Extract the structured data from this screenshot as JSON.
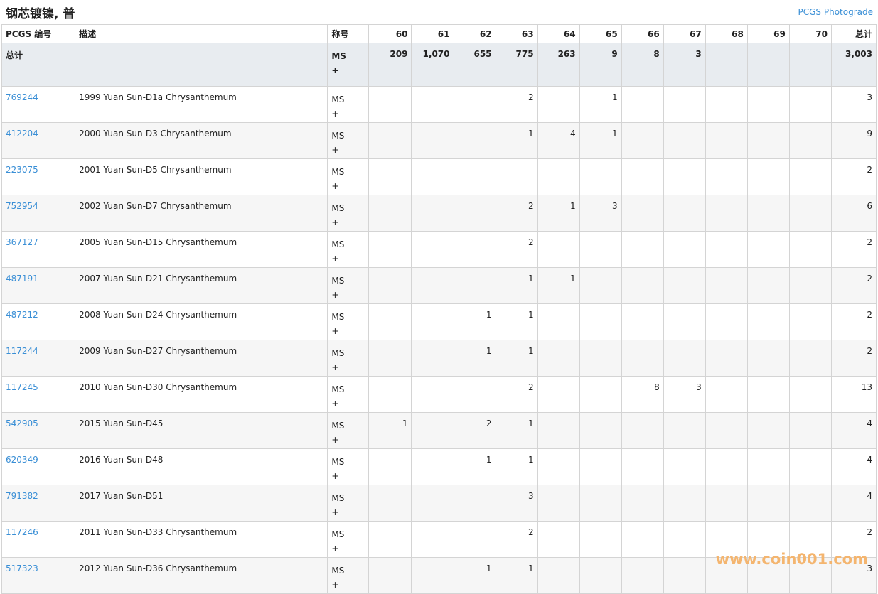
{
  "page": {
    "title": "钢芯镀镍, 普",
    "photograde_link": "PCGS Photograde",
    "watermark": "www.coin001.com"
  },
  "table": {
    "headers": {
      "pcgs_no": "PCGS 编号",
      "description": "描述",
      "designation": "称号",
      "grades": [
        "60",
        "61",
        "62",
        "63",
        "64",
        "65",
        "66",
        "67",
        "68",
        "69",
        "70"
      ],
      "total": "总计"
    },
    "total_row": {
      "label": "总计",
      "designation": [
        "MS",
        "+"
      ],
      "grades": [
        "209",
        "1,070",
        "655",
        "775",
        "263",
        "9",
        "8",
        "3",
        "",
        "",
        ""
      ],
      "total": "3,003"
    },
    "rows": [
      {
        "pcgs": "769244",
        "desc": "1999 Yuan Sun-D1a Chrysanthemum",
        "des": [
          "MS",
          "+"
        ],
        "grades": [
          "",
          "",
          "",
          "2",
          "",
          "1",
          "",
          "",
          "",
          "",
          ""
        ],
        "total": "3"
      },
      {
        "pcgs": "412204",
        "desc": "2000 Yuan Sun-D3 Chrysanthemum",
        "des": [
          "MS",
          "+"
        ],
        "grades": [
          "",
          "",
          "",
          "1",
          "4",
          "1",
          "",
          "",
          "",
          "",
          ""
        ],
        "total": "9"
      },
      {
        "pcgs": "223075",
        "desc": "2001 Yuan Sun-D5 Chrysanthemum",
        "des": [
          "MS",
          "+"
        ],
        "grades": [
          "",
          "",
          "",
          "",
          "",
          "",
          "",
          "",
          "",
          "",
          ""
        ],
        "total": "2"
      },
      {
        "pcgs": "752954",
        "desc": "2002 Yuan Sun-D7 Chrysanthemum",
        "des": [
          "MS",
          "+"
        ],
        "grades": [
          "",
          "",
          "",
          "2",
          "1",
          "3",
          "",
          "",
          "",
          "",
          ""
        ],
        "total": "6"
      },
      {
        "pcgs": "367127",
        "desc": "2005 Yuan Sun-D15 Chrysanthemum",
        "des": [
          "MS",
          "+"
        ],
        "grades": [
          "",
          "",
          "",
          "2",
          "",
          "",
          "",
          "",
          "",
          "",
          ""
        ],
        "total": "2"
      },
      {
        "pcgs": "487191",
        "desc": "2007 Yuan Sun-D21 Chrysanthemum",
        "des": [
          "MS",
          "+"
        ],
        "grades": [
          "",
          "",
          "",
          "1",
          "1",
          "",
          "",
          "",
          "",
          "",
          ""
        ],
        "total": "2"
      },
      {
        "pcgs": "487212",
        "desc": "2008 Yuan Sun-D24 Chrysanthemum",
        "des": [
          "MS",
          "+"
        ],
        "grades": [
          "",
          "",
          "1",
          "1",
          "",
          "",
          "",
          "",
          "",
          "",
          ""
        ],
        "total": "2"
      },
      {
        "pcgs": "117244",
        "desc": "2009 Yuan Sun-D27 Chrysanthemum",
        "des": [
          "MS",
          "+"
        ],
        "grades": [
          "",
          "",
          "1",
          "1",
          "",
          "",
          "",
          "",
          "",
          "",
          ""
        ],
        "total": "2"
      },
      {
        "pcgs": "117245",
        "desc": "2010 Yuan Sun-D30 Chrysanthemum",
        "des": [
          "MS",
          "+"
        ],
        "grades": [
          "",
          "",
          "",
          "2",
          "",
          "",
          "8",
          "3",
          "",
          "",
          ""
        ],
        "total": "13"
      },
      {
        "pcgs": "542905",
        "desc": "2015 Yuan Sun-D45",
        "des": [
          "MS",
          "+"
        ],
        "grades": [
          "1",
          "",
          "2",
          "1",
          "",
          "",
          "",
          "",
          "",
          "",
          ""
        ],
        "total": "4"
      },
      {
        "pcgs": "620349",
        "desc": "2016 Yuan Sun-D48",
        "des": [
          "MS",
          "+"
        ],
        "grades": [
          "",
          "",
          "1",
          "1",
          "",
          "",
          "",
          "",
          "",
          "",
          ""
        ],
        "total": "4"
      },
      {
        "pcgs": "791382",
        "desc": "2017 Yuan Sun-D51",
        "des": [
          "MS",
          "+"
        ],
        "grades": [
          "",
          "",
          "",
          "3",
          "",
          "",
          "",
          "",
          "",
          "",
          ""
        ],
        "total": "4"
      },
      {
        "pcgs": "117246",
        "desc": "2011 Yuan Sun-D33 Chrysanthemum",
        "des": [
          "MS",
          "+"
        ],
        "grades": [
          "",
          "",
          "",
          "2",
          "",
          "",
          "",
          "",
          "",
          "",
          ""
        ],
        "total": "2"
      },
      {
        "pcgs": "517323",
        "desc": "2012 Yuan Sun-D36 Chrysanthemum",
        "des": [
          "MS",
          "+"
        ],
        "grades": [
          "",
          "",
          "1",
          "1",
          "",
          "",
          "",
          "",
          "",
          "",
          ""
        ],
        "total": "3"
      }
    ]
  }
}
